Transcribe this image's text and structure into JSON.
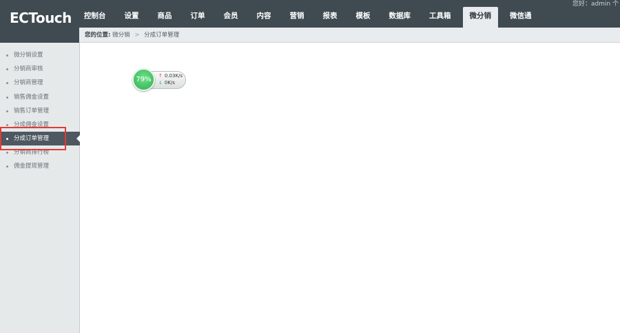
{
  "brand": {
    "logo": "ECTouch"
  },
  "user": {
    "greeting": "您好：admin  个"
  },
  "nav": {
    "items": [
      "控制台",
      "设置",
      "商品",
      "订单",
      "会员",
      "内容",
      "营销",
      "报表",
      "模板",
      "数据库",
      "工具箱",
      "微分销",
      "微信通"
    ],
    "active_index": 11
  },
  "breadcrumb": {
    "prefix": "您的位置:",
    "level1": "微分销",
    "sep": ">",
    "level2": "分成订单管理"
  },
  "sidebar": {
    "items": [
      "微分销设置",
      "分销商审核",
      "分销商管理",
      "销售佣金设置",
      "销售订单管理",
      "分成佣金设置",
      "分成订单管理",
      "分销商排行榜",
      "佣金提现管理"
    ],
    "active_index": 6
  },
  "widget": {
    "percent": "79%",
    "up_speed": "0.03K/s",
    "down_speed": "0K/s",
    "up_arrow": "↑",
    "down_arrow": "↓"
  },
  "colors": {
    "topbar": "#3f4a51",
    "accent_green": "#2eb04f",
    "highlight": "#e53935"
  }
}
